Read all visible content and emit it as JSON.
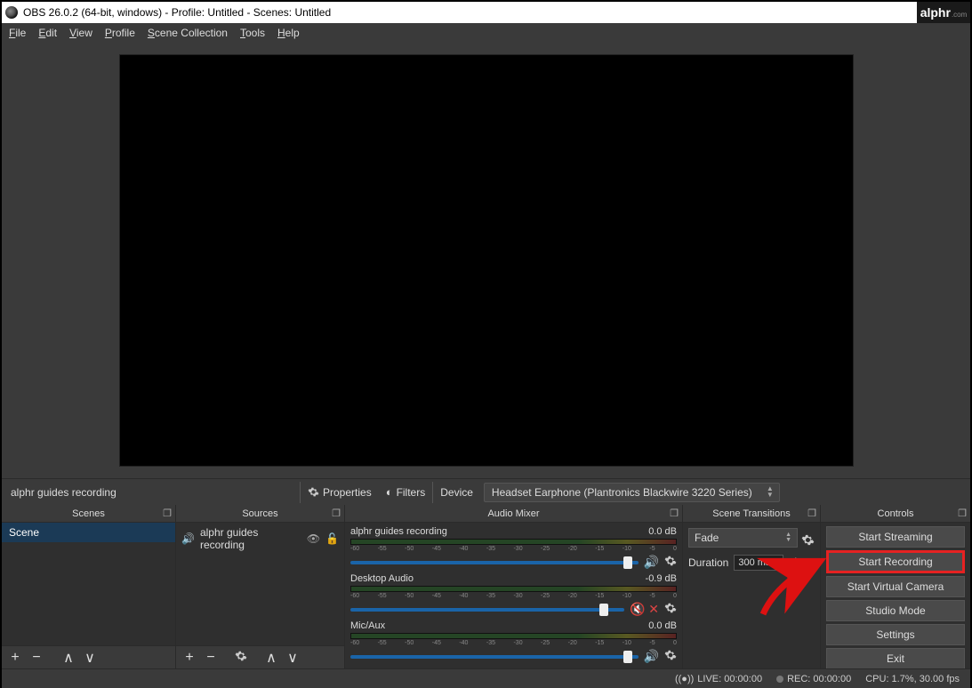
{
  "title": "OBS 26.0.2 (64-bit, windows) - Profile: Untitled - Scenes: Untitled",
  "logo": {
    "name": "alphr",
    "suffix": ".com"
  },
  "menu": {
    "file": "File",
    "edit": "Edit",
    "view": "View",
    "profile": "Profile",
    "scene_collection": "Scene Collection",
    "tools": "Tools",
    "help": "Help"
  },
  "toolbar": {
    "scene_label": "alphr guides recording",
    "properties": "Properties",
    "filters": "Filters",
    "device_label": "Device",
    "device_value": "Headset Earphone (Plantronics Blackwire 3220 Series)"
  },
  "docks": {
    "scenes": "Scenes",
    "sources": "Sources",
    "mixer": "Audio Mixer",
    "transitions": "Scene Transitions",
    "controls": "Controls"
  },
  "scenes": {
    "items": [
      "Scene"
    ]
  },
  "sources": {
    "items": [
      "alphr guides recording"
    ]
  },
  "mixer": {
    "channels": [
      {
        "name": "alphr guides recording",
        "db": "0.0 dB",
        "thumb_pct": 95,
        "muted": false
      },
      {
        "name": "Desktop Audio",
        "db": "-0.9 dB",
        "thumb_pct": 91,
        "muted": true
      },
      {
        "name": "Mic/Aux",
        "db": "0.0 dB",
        "thumb_pct": 95,
        "muted": false
      }
    ],
    "ticks": [
      "-60",
      "-55",
      "-50",
      "-45",
      "-40",
      "-35",
      "-30",
      "-25",
      "-20",
      "-15",
      "-10",
      "-5",
      "0"
    ]
  },
  "transitions": {
    "selected": "Fade",
    "duration_label": "Duration",
    "duration_value": "300 ms"
  },
  "controls": {
    "buttons": [
      "Start Streaming",
      "Start Recording",
      "Start Virtual Camera",
      "Studio Mode",
      "Settings",
      "Exit"
    ],
    "highlight_index": 1
  },
  "status": {
    "live": "LIVE: 00:00:00",
    "rec": "REC: 00:00:00",
    "cpu": "CPU: 1.7%, 30.00 fps"
  }
}
